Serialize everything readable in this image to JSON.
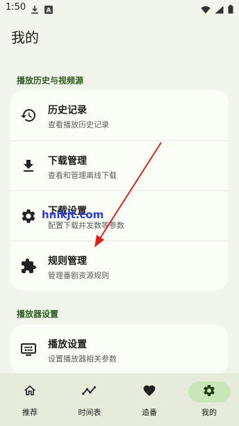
{
  "status_bar": {
    "time": "1:50",
    "left_icons": [
      "download-icon",
      "a-letter-icon"
    ],
    "right_icons": [
      "wifi-icon",
      "signal-icon",
      "battery-icon"
    ]
  },
  "page": {
    "title": "我的"
  },
  "sections": [
    {
      "title": "播放历史与视频源",
      "items": [
        {
          "title": "历史记录",
          "subtitle": "查看播放历史记录",
          "icon": "history-icon"
        },
        {
          "title": "下载管理",
          "subtitle": "查看和管理离线下载",
          "icon": "download-icon"
        },
        {
          "title": "下载设置",
          "subtitle": "配置下载并发数等参数",
          "icon": "gear-icon"
        },
        {
          "title": "规则管理",
          "subtitle": "管理番剧资源规则",
          "icon": "puzzle-icon"
        }
      ]
    },
    {
      "title": "播放器设置",
      "items": [
        {
          "title": "播放设置",
          "subtitle": "设置播放器相关参数",
          "icon": "tv-settings-icon"
        }
      ]
    }
  ],
  "bottom_nav": [
    {
      "label": "推荐",
      "icon": "home-icon",
      "active": false
    },
    {
      "label": "时间表",
      "icon": "timeline-icon",
      "active": false
    },
    {
      "label": "追番",
      "icon": "heart-icon",
      "active": false
    },
    {
      "label": "我的",
      "icon": "gear-icon",
      "active": true
    }
  ],
  "watermark": "hnlkjt.com",
  "colors": {
    "background": "#f2f5ec",
    "card": "#fbfdf7",
    "section_title": "#2d5a1e",
    "nav_background": "#e6ebdc",
    "nav_active_pill": "#c9e6b7",
    "annotation_arrow": "#e02020",
    "watermark": "#2b3bd6"
  }
}
